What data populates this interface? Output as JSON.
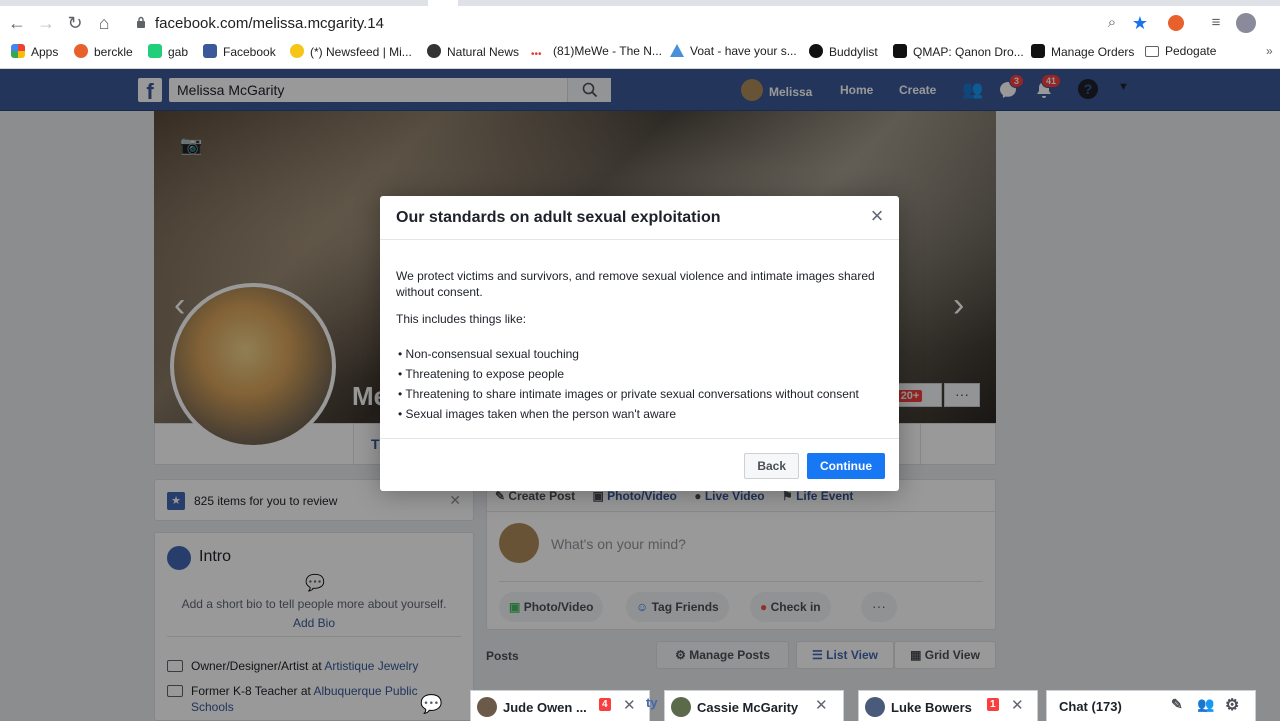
{
  "browser": {
    "url": "facebook.com/melissa.mcgarity.14",
    "bookmarks": [
      "Apps",
      "berckle",
      "gab",
      "Facebook",
      "(*) Newsfeed | Mi...",
      "Natural News",
      "(81)MeWe - The N...",
      "Voat - have your s...",
      "Buddylist",
      "QMAP: Qanon Dro...",
      "Manage Orders",
      "Pedogate"
    ]
  },
  "fb": {
    "search_value": "Melissa McGarity",
    "nav_name": "Melissa",
    "nav_home": "Home",
    "nav_create": "Create",
    "messages_badge": "3",
    "notifications_badge": "41"
  },
  "cover": {
    "name_partial": "Me",
    "partial_label": "g",
    "badge_20": "20+",
    "timeline_partial": "T"
  },
  "modal": {
    "title": "Our standards on adult sexual exploitation",
    "intro": "We protect victims and survivors, and remove sexual violence and intimate images shared without consent.",
    "includes": "This includes things like:",
    "bullets": [
      "• Non-consensual sexual touching",
      "• Threatening to expose people",
      "• Threatening to share intimate images or private sexual conversations without consent",
      "• Sexual images taken when the person wan't aware"
    ],
    "back": "Back",
    "continue": "Continue"
  },
  "left": {
    "review": "825 items for you to review",
    "intro_title": "Intro",
    "bio_prompt": "Add a short bio to tell people more about yourself.",
    "add_bio": "Add Bio",
    "work_prefix": "Owner/Designer/Artist at ",
    "work_link": "Artistique Jewelry",
    "teach_prefix": "Former K-8 Teacher at ",
    "teach_link": "Albuquerque Public",
    "teach_link2": "Schools"
  },
  "composer": {
    "tabs": [
      "Create Post",
      "Photo/Video",
      "Live Video",
      "Life Event"
    ],
    "placeholder": "What's on your mind?",
    "actions": [
      "Photo/Video",
      "Tag Friends",
      "Check in"
    ]
  },
  "posts": {
    "label": "Posts",
    "manage": "Manage Posts",
    "list_view": "List View",
    "grid_view": "Grid View"
  },
  "chat": {
    "tabs": [
      {
        "name": "Jude Owen ...",
        "badge": "4"
      },
      {
        "name": "Cassie McGarity",
        "badge": ""
      },
      {
        "name": "Luke Bowers",
        "badge": "1"
      }
    ],
    "partial": "ty",
    "sidebar": "Chat (173)"
  }
}
